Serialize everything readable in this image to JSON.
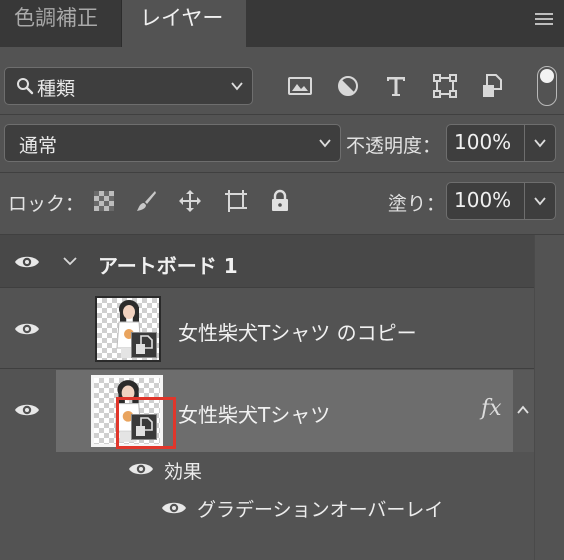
{
  "tabs": [
    {
      "label": "色調補正",
      "active": false
    },
    {
      "label": "レイヤー",
      "active": true
    }
  ],
  "filter": {
    "kind_label": "種類",
    "icons": [
      "image-filter-icon",
      "adjustment-filter-icon",
      "type-filter-icon",
      "shape-filter-icon",
      "smart-object-filter-icon"
    ]
  },
  "blend": {
    "mode": "通常",
    "opacity_label": "不透明度：",
    "opacity_value": "100%"
  },
  "lock": {
    "label": "ロック：",
    "fill_label": "塗り：",
    "fill_value": "100%"
  },
  "layers": {
    "artboard_name": "アートボード 1",
    "copy_layer_name": "女性柴犬Tシャツ のコピー",
    "selected_layer_name": "女性柴犬Tシャツ",
    "fx_label": "fx",
    "effects_label": "効果",
    "effect_item": "グラデーションオーバーレイ"
  },
  "colors": {
    "panel_bg": "#535353",
    "tab_bar_bg": "#383838",
    "selected_row": "#6d6d6d",
    "highlight": "#e0362b"
  }
}
